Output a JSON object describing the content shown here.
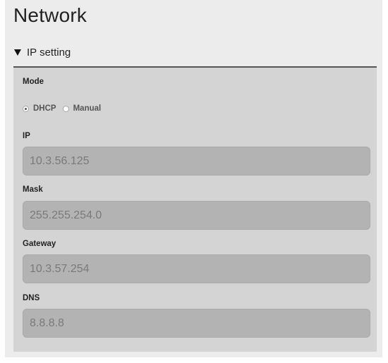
{
  "page": {
    "title": "Network"
  },
  "section": {
    "header": "IP setting",
    "expanded": true
  },
  "mode": {
    "label": "Mode",
    "options": [
      "DHCP",
      "Manual"
    ],
    "selected": "DHCP"
  },
  "fields": {
    "ip": {
      "label": "IP",
      "value": "10.3.56.125"
    },
    "mask": {
      "label": "Mask",
      "value": "255.255.254.0"
    },
    "gateway": {
      "label": "Gateway",
      "value": "10.3.57.254"
    },
    "dns": {
      "label": "DNS",
      "value": "8.8.8.8"
    }
  }
}
